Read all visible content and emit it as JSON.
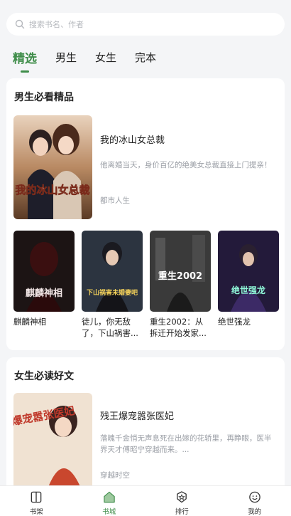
{
  "search": {
    "placeholder": "搜索书名、作者"
  },
  "tabs": [
    {
      "label": "精选",
      "active": true
    },
    {
      "label": "男生",
      "active": false
    },
    {
      "label": "女生",
      "active": false
    },
    {
      "label": "完本",
      "active": false
    }
  ],
  "section_male": {
    "title": "男生必看精品",
    "featured": {
      "title": "我的冰山女总裁",
      "description": "他离婚当天，身价百亿的绝美女总裁直接上门提亲！",
      "tag": "都市人生",
      "cover_text": "我的冰山女总裁"
    },
    "books": [
      {
        "title": "麒麟神相",
        "cover_text": "麒麟神相"
      },
      {
        "title": "徒儿，你无敌了，下山祸害...",
        "cover_text": "下山祸害未婚妻吧"
      },
      {
        "title": "重生2002：从拆迁开始发家...",
        "cover_text": "重生2002"
      },
      {
        "title": "绝世强龙",
        "cover_text": "绝世强龙"
      }
    ]
  },
  "section_female": {
    "title": "女生必读好文",
    "featured": {
      "title": "残王爆宠嚣张医妃",
      "description": "落魄千金悄无声息死在出嫁的花轿里，再睁眼，医半界天才傅昭宁穿越而来。...",
      "tag": "穿越时空",
      "cover_text": "残王爆宠嚣张医妃"
    }
  },
  "bottom_nav": [
    {
      "label": "书架",
      "icon": "book-icon",
      "active": false
    },
    {
      "label": "书城",
      "icon": "home-icon",
      "active": true
    },
    {
      "label": "排行",
      "icon": "rank-badge-icon",
      "active": false
    },
    {
      "label": "我的",
      "icon": "smiley-icon",
      "active": false
    }
  ],
  "colors": {
    "accent": "#3f8d4a",
    "background": "#f4f5f7"
  }
}
